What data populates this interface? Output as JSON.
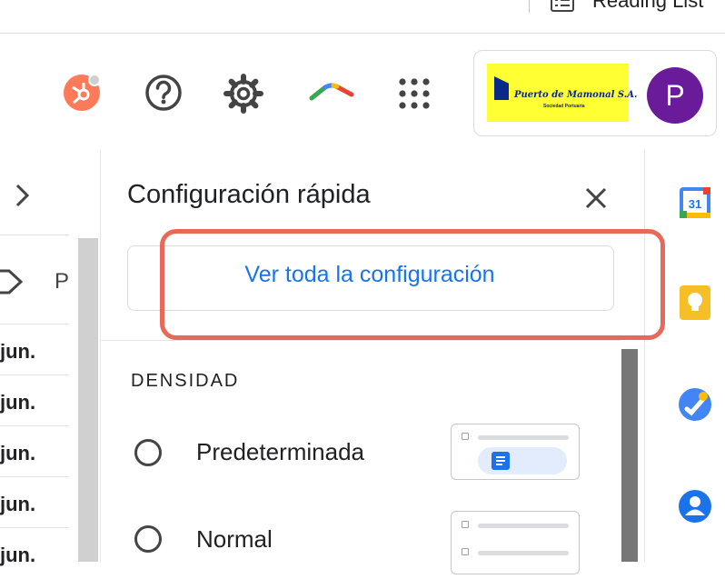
{
  "browser": {
    "reading_list_label": "Reading List"
  },
  "header": {
    "icons": [
      "hubspot-icon",
      "help-icon",
      "settings-icon",
      "drive-arc-icon",
      "apps-grid-icon"
    ],
    "company_logo": {
      "name": "Puerto de Mamonal S.A.",
      "tagline": "Sociedad Portuaria"
    },
    "avatar_letter": "P"
  },
  "mail_list": {
    "column_header": "P",
    "rows": [
      "jun.",
      "jun.",
      "jun.",
      "jun.",
      "jun."
    ]
  },
  "quick_settings": {
    "title": "Configuración rápida",
    "see_all_label": "Ver toda la configuración",
    "density_heading": "DENSIDAD",
    "options": [
      {
        "label": "Predeterminada",
        "selected": false
      },
      {
        "label": "Normal",
        "selected": false
      }
    ]
  },
  "side_rail": {
    "icons": [
      "calendar-icon",
      "keep-icon",
      "tasks-icon",
      "contacts-icon"
    ],
    "calendar_day": "31"
  },
  "colors": {
    "accent_blue": "#1a73e8",
    "highlight_red": "#e8685a",
    "avatar_purple": "#6a1b9a",
    "logo_yellow": "#ffff33"
  }
}
